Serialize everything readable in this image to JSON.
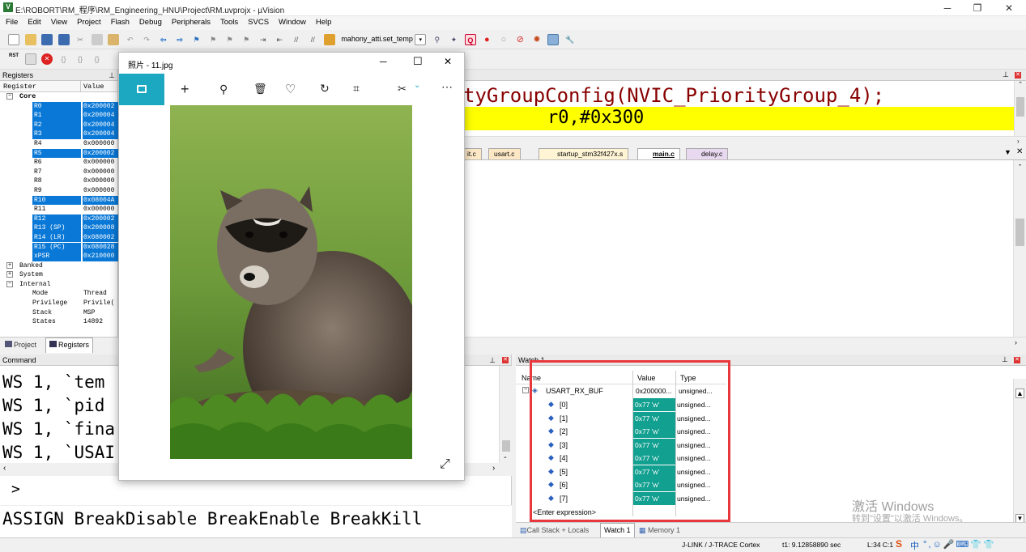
{
  "window": {
    "title": "E:\\ROBORT\\RM_程序\\RM_Engineering_HNU\\Project\\RM.uvprojx - µVision",
    "minimize": "─",
    "maximize": "❐",
    "close": "✕"
  },
  "menu": [
    "File",
    "Edit",
    "View",
    "Project",
    "Flash",
    "Debug",
    "Peripherals",
    "Tools",
    "SVCS",
    "Window",
    "Help"
  ],
  "toolbar": {
    "target_dropdown": "mahony_atti.set_temp",
    "rst_label": "RST"
  },
  "registers_panel": {
    "title": "Registers",
    "col_register": "Register",
    "col_value": "Value",
    "core_label": "Core",
    "rows": [
      {
        "name": "R0",
        "value": "0x200002",
        "selected": true
      },
      {
        "name": "R1",
        "value": "0x200004",
        "selected": true
      },
      {
        "name": "R2",
        "value": "0x200004",
        "selected": true
      },
      {
        "name": "R3",
        "value": "0x200004",
        "selected": true
      },
      {
        "name": "R4",
        "value": "0x000000",
        "selected": false
      },
      {
        "name": "R5",
        "value": "0x200002",
        "selected": true
      },
      {
        "name": "R6",
        "value": "0x000000",
        "selected": false
      },
      {
        "name": "R7",
        "value": "0x000000",
        "selected": false
      },
      {
        "name": "R8",
        "value": "0x000000",
        "selected": false
      },
      {
        "name": "R9",
        "value": "0x000000",
        "selected": false
      },
      {
        "name": "R10",
        "value": "0x08004A",
        "selected": true
      },
      {
        "name": "R11",
        "value": "0x000000",
        "selected": false
      },
      {
        "name": "R12",
        "value": "0x200002",
        "selected": true
      },
      {
        "name": "R13 (SP)",
        "value": "0x200008",
        "selected": true
      },
      {
        "name": "R14 (LR)",
        "value": "0x080002",
        "selected": true
      },
      {
        "name": "R15 (PC)",
        "value": "0x080028",
        "selected": true
      },
      {
        "name": "xPSR",
        "value": "0x210000",
        "selected": true
      }
    ],
    "groups": [
      "Banked",
      "System",
      "Internal"
    ],
    "internal_rows": [
      {
        "name": "Mode",
        "value": "Thread"
      },
      {
        "name": "Privilege",
        "value": "Privile("
      },
      {
        "name": "Stack",
        "value": "MSP"
      },
      {
        "name": "States",
        "value": "14892"
      }
    ],
    "tab_project": "Project",
    "tab_registers": "Registers"
  },
  "disassembly": {
    "line1": "tyGroupConfig(NVIC_PriorityGroup_4);",
    "line2": "r0,#0x300"
  },
  "editor_tabs": [
    "it.c",
    "usart.c",
    "startup_stm32f427x.s",
    "main.c",
    "delay.c"
  ],
  "active_tab": "main.c",
  "command": {
    "title": "Command",
    "lines": [
      "WS 1, `tem",
      "WS 1, `pid",
      "WS 1, `fina",
      "WS 1, `USAI"
    ],
    "prompt": ">",
    "hint": "ASSIGN BreakDisable BreakEnable BreakKill"
  },
  "photos": {
    "title": "照片 - 11.jpg",
    "min": "─",
    "max": "☐",
    "close": "✕",
    "tools": [
      "image",
      "add",
      "zoom",
      "delete",
      "favorite",
      "rotate",
      "crop",
      "edit",
      "more"
    ]
  },
  "watch": {
    "title": "Watch 1",
    "col_name": "Name",
    "col_value": "Value",
    "col_type": "Type",
    "root": {
      "name": "USART_RX_BUF",
      "value": "0x200000...",
      "type": "unsigned..."
    },
    "items": [
      {
        "name": "[0]",
        "value": "0x77 'w'",
        "type": "unsigned..."
      },
      {
        "name": "[1]",
        "value": "0x77 'w'",
        "type": "unsigned..."
      },
      {
        "name": "[2]",
        "value": "0x77 'w'",
        "type": "unsigned..."
      },
      {
        "name": "[3]",
        "value": "0x77 'w'",
        "type": "unsigned..."
      },
      {
        "name": "[4]",
        "value": "0x77 'w'",
        "type": "unsigned..."
      },
      {
        "name": "[5]",
        "value": "0x77 'w'",
        "type": "unsigned..."
      },
      {
        "name": "[6]",
        "value": "0x77 'w'",
        "type": "unsigned..."
      },
      {
        "name": "[7]",
        "value": "0x77 'w'",
        "type": "unsigned..."
      }
    ],
    "enter_expression": "<Enter expression>",
    "tabs": [
      "Call Stack + Locals",
      "Watch 1",
      "Memory 1"
    ],
    "highlight_color": "#e8383d"
  },
  "activation": {
    "line1": "激活 Windows",
    "line2": "转到\"设置\"以激活 Windows。"
  },
  "status": {
    "debugger": "J-LINK / J-TRACE Cortex",
    "time": "t1: 9.12858890 sec",
    "position": "L:34 C:1"
  },
  "ime": {
    "lang": "中",
    "items": "°,☺🎤⌨👕👕"
  }
}
